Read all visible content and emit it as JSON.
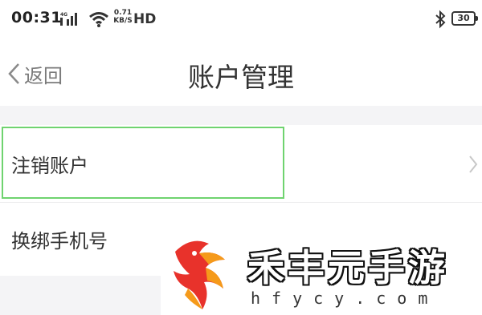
{
  "status_bar": {
    "time": "00:31",
    "network_speed": [
      "0.71",
      "KB/S"
    ],
    "hd_label": "HD",
    "battery": "30",
    "icons": [
      "signal-icon",
      "wifi-icon",
      "bluetooth-icon",
      "battery-icon"
    ]
  },
  "nav": {
    "back_label": "返回",
    "title": "账户管理"
  },
  "items": [
    {
      "label": "注销账户",
      "has_chevron": true
    },
    {
      "label": "换绑手机号",
      "has_chevron": false
    }
  ],
  "watermark": {
    "text": "禾丰元手游",
    "url": "hfycy.com"
  },
  "colors": {
    "background": "#f4f4f6",
    "highlight": "#6fd36f",
    "logo_red": "#e8322b",
    "logo_orange": "#f59a1b"
  }
}
